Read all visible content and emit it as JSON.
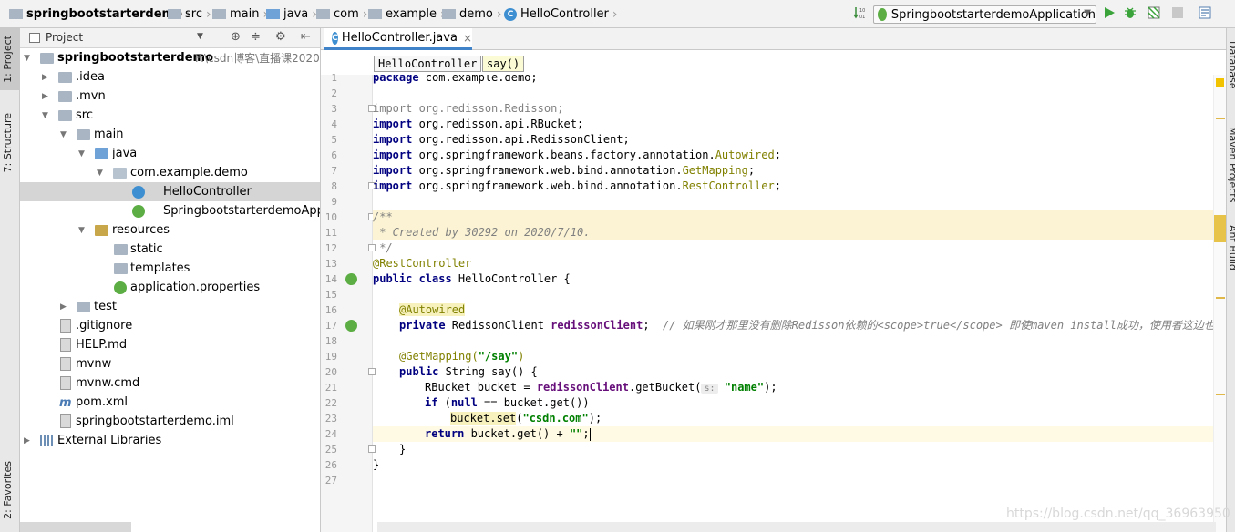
{
  "navbar": {
    "crumbs": [
      "springbootstarterdemo",
      "src",
      "main",
      "java",
      "com",
      "example",
      "demo",
      "HelloController"
    ],
    "run_config": "SpringbootstarterdemoApplication"
  },
  "left_strip": {
    "tab_project": "1: Project",
    "tab_structure": "7: Structure",
    "tab_favorites": "2: Favorites"
  },
  "project_panel": {
    "title": "Project",
    "tree": [
      {
        "label": "springbootstarterdemo",
        "path": "F:\\csdn博客\\直播课2020",
        "icon": "folder-icon"
      },
      {
        "label": ".idea",
        "icon": "folder-icon"
      },
      {
        "label": ".mvn",
        "icon": "folder-icon"
      },
      {
        "label": "src",
        "icon": "folder-icon"
      },
      {
        "label": "main",
        "icon": "folder-icon"
      },
      {
        "label": "java",
        "icon": "source-folder-icon"
      },
      {
        "label": "com.example.demo",
        "icon": "package-icon"
      },
      {
        "label": "HelloController",
        "icon": "class-icon"
      },
      {
        "label": "SpringbootstarterdemoApplic",
        "icon": "spring-boot-class-icon"
      },
      {
        "label": "resources",
        "icon": "resources-folder-icon"
      },
      {
        "label": "static",
        "icon": "folder-icon"
      },
      {
        "label": "templates",
        "icon": "folder-icon"
      },
      {
        "label": "application.properties",
        "icon": "spring-properties-icon"
      },
      {
        "label": "test",
        "icon": "folder-icon"
      },
      {
        "label": ".gitignore",
        "icon": "file-icon"
      },
      {
        "label": "HELP.md",
        "icon": "markdown-icon"
      },
      {
        "label": "mvnw",
        "icon": "file-icon"
      },
      {
        "label": "mvnw.cmd",
        "icon": "file-icon"
      },
      {
        "label": "pom.xml",
        "icon": "maven-icon"
      },
      {
        "label": "springbootstarterdemo.iml",
        "icon": "iml-icon"
      },
      {
        "label": "External Libraries",
        "icon": "libraries-icon"
      }
    ]
  },
  "editor": {
    "tab_label": "HelloController.java",
    "tab_close": "×",
    "breadcrumb_class": "HelloController",
    "breadcrumb_method": "say()",
    "line_numbers": [
      "1",
      "2",
      "3",
      "4",
      "5",
      "6",
      "7",
      "8",
      "9",
      "10",
      "11",
      "12",
      "13",
      "14",
      "15",
      "16",
      "17",
      "18",
      "19",
      "20",
      "21",
      "22",
      "23",
      "24",
      "25",
      "26",
      "27"
    ],
    "code": {
      "l1_kw": "package",
      "l1_rest": " com.example.demo;",
      "l3_kw": "import",
      "l3_rest": " org.redisson.Redisson;",
      "l4_kw": "import",
      "l4_rest": " org.redisson.api.RBucket;",
      "l5_kw": "import",
      "l5_rest": " org.redisson.api.RedissonClient;",
      "l6_kw": "import",
      "l6_rest": " org.springframework.beans.factory.annotation.",
      "l6_ann": "Autowired",
      "l6_end": ";",
      "l7_kw": "import",
      "l7_rest": " org.springframework.web.bind.annotation.",
      "l7_ann": "GetMapping",
      "l7_end": ";",
      "l8_kw": "import",
      "l8_rest": " org.springframework.web.bind.annotation.",
      "l8_ann": "RestController",
      "l8_end": ";",
      "l10": "/**",
      "l11": " * Created by 30292 on 2020/7/10.",
      "l12": " */",
      "l13": "@RestController",
      "l14_kw": "public class",
      "l14_rest": " HelloController {",
      "l16": "@Autowired",
      "l17_kw": "private",
      "l17_type": " RedissonClient ",
      "l17_fld": "redissonClient",
      "l17_semi": ";",
      "l17_cmt": "  // 如果刚才那里没有删除Redisson依赖的<scope>true</scope> 即使maven install成功，使用者这边也无法",
      "l19_ann": "@GetMapping(",
      "l19_str": "\"/say\"",
      "l19_end": ")",
      "l20_kw": "public",
      "l20_rest": " String say() {",
      "l21_a": "RBucket bucket = ",
      "l21_fld": "redissonClient",
      "l21_b": ".getBucket(",
      "l21_hint": "s:",
      "l21_str": "\"name\"",
      "l21_c": ");",
      "l22_kw": "if",
      "l22_a": " (",
      "l22_kw2": "null",
      "l22_b": " == bucket.get())",
      "l23_a": "bucket.set",
      "l23_b": "(",
      "l23_str": "\"csdn.com\"",
      "l23_c": ");",
      "l24_kw": "return",
      "l24_a": " bucket.get() + ",
      "l24_str": "\"\"",
      "l24_c": ";",
      "l25": "}",
      "l26": "}"
    }
  },
  "right_strip": {
    "tab_database": "Database",
    "tab_maven": "Maven Projects",
    "tab_ant": "Ant Build"
  },
  "watermark": "https://blog.csdn.net/qq_36963950"
}
